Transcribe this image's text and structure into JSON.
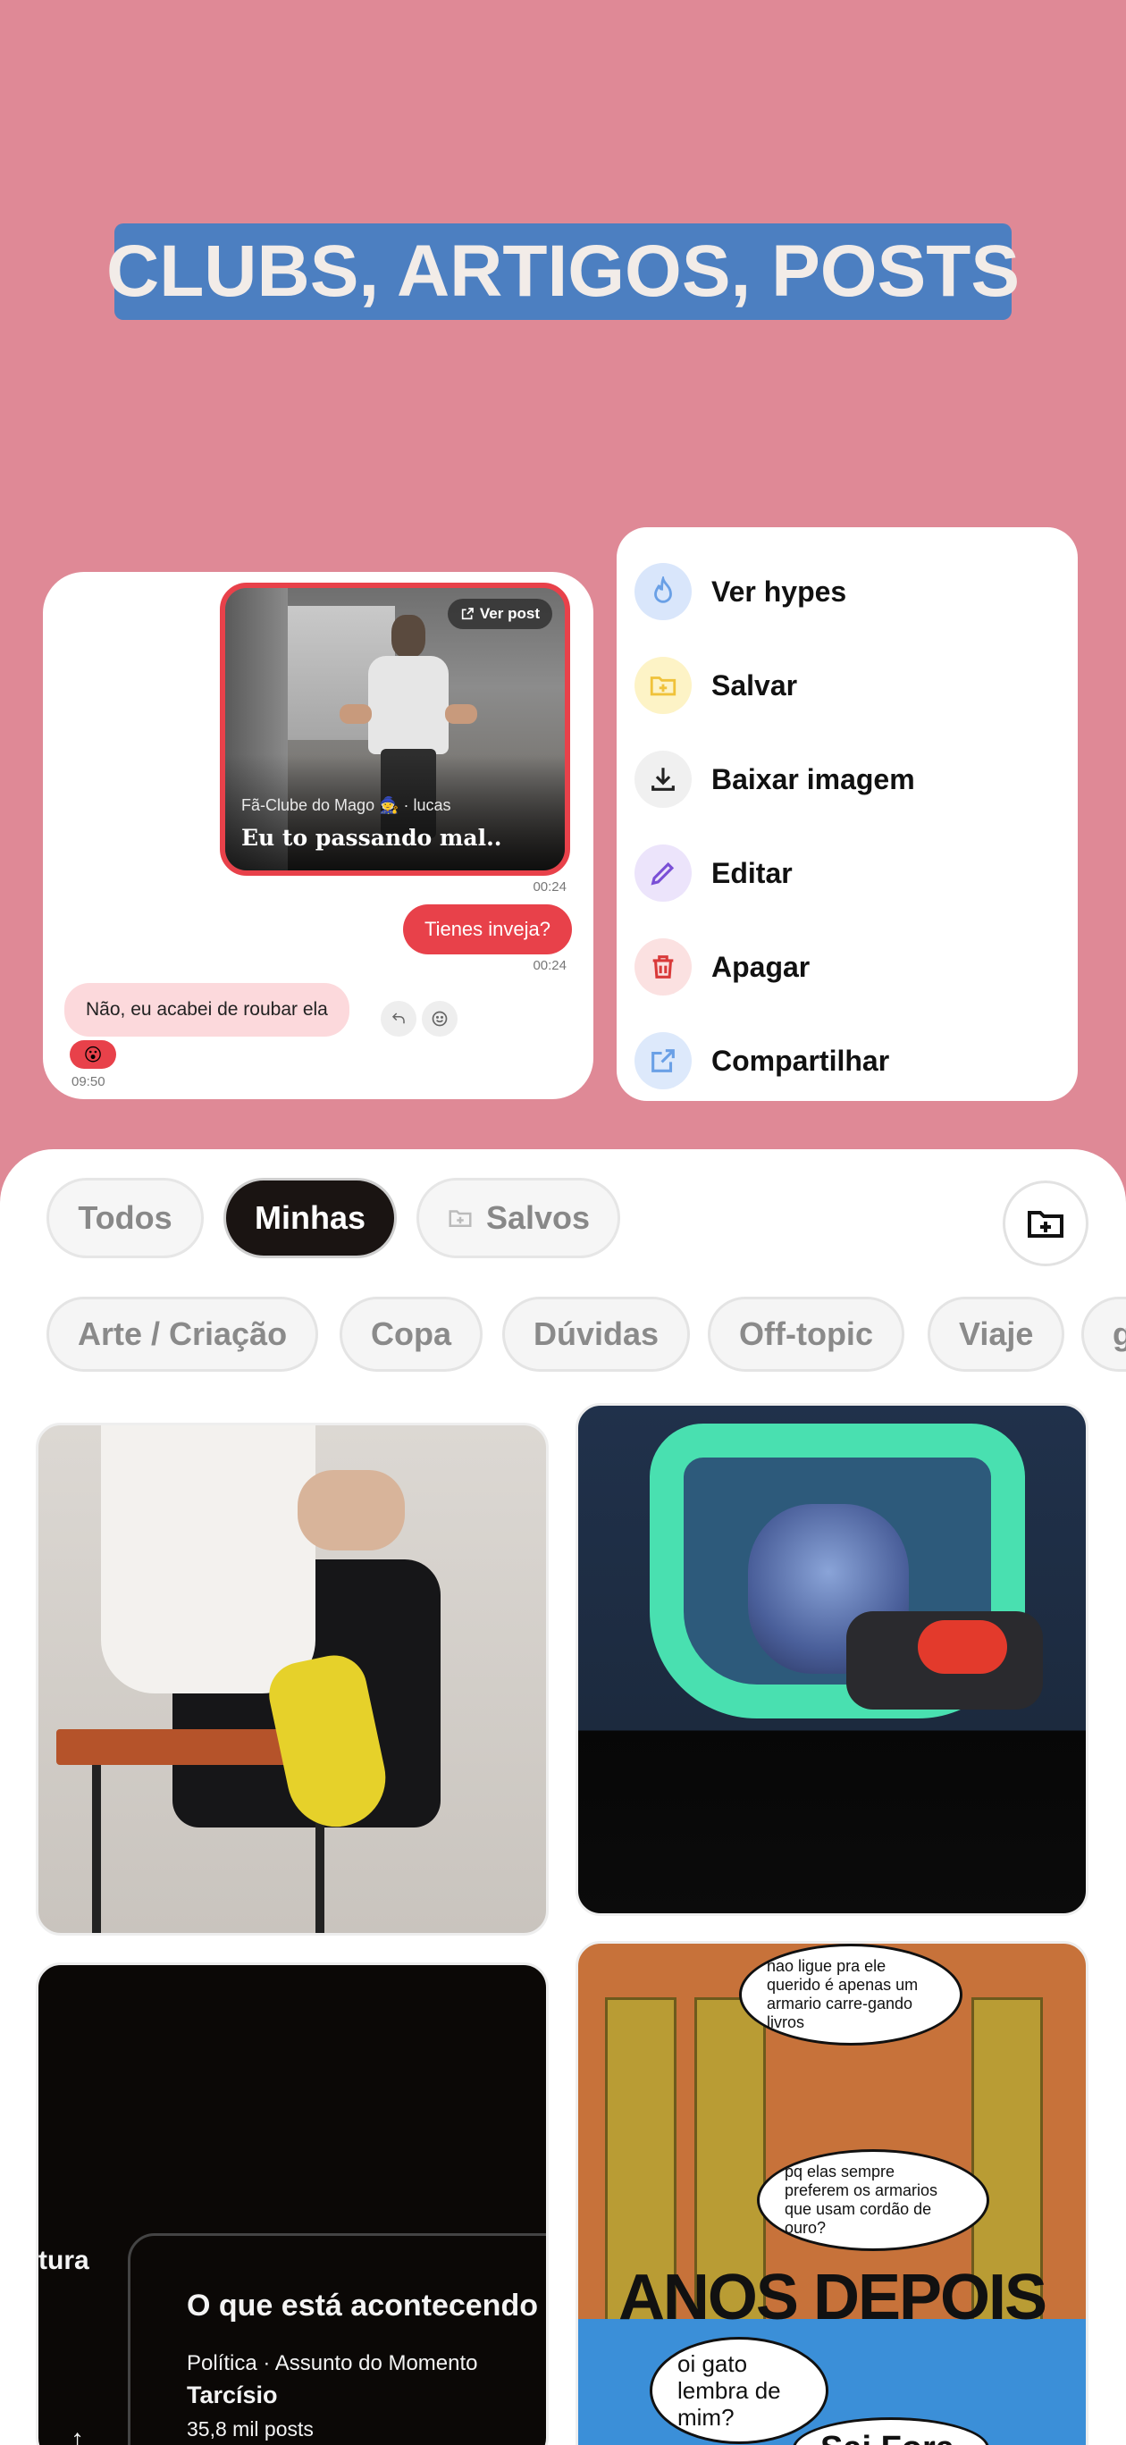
{
  "hero": {
    "title": "CLUBS, ARTIGOS, POSTS"
  },
  "chat": {
    "shared_post": {
      "button_label": "Ver post",
      "meta": "Fã-Clube do Mago 🧙 · lucas",
      "caption": "Eu to passando mal.."
    },
    "messages": [
      {
        "direction": "out",
        "type": "post",
        "time": "00:24"
      },
      {
        "direction": "out",
        "text": "Tienes inveja?",
        "time": "00:24"
      },
      {
        "direction": "in",
        "text": "Não, eu acabei de roubar ela",
        "time": "09:50",
        "reaction": "😮"
      }
    ]
  },
  "menu": {
    "items": [
      {
        "label": "Ver hypes",
        "icon": "flame-icon",
        "color": "#d9e6fb"
      },
      {
        "label": "Salvar",
        "icon": "folder-plus-icon",
        "color": "#fdf3c6"
      },
      {
        "label": "Baixar imagem",
        "icon": "download-icon",
        "color": "#f0f0f0"
      },
      {
        "label": "Editar",
        "icon": "pencil-icon",
        "color": "#ece4fb"
      },
      {
        "label": "Apagar",
        "icon": "trash-icon",
        "color": "#fbe1e1"
      },
      {
        "label": "Compartilhar",
        "icon": "share-icon",
        "color": "#dde9fb"
      }
    ]
  },
  "feed": {
    "tabs": [
      {
        "label": "Todos",
        "active": false
      },
      {
        "label": "Minhas",
        "active": true
      },
      {
        "label": "Salvos",
        "active": false
      }
    ],
    "categories": [
      "Arte / Criação",
      "Copa",
      "Dúvidas",
      "Off-topic",
      "Viaje",
      "g"
    ],
    "tiles": {
      "t3": {
        "side_text": "tura",
        "heading": "O que está acontecendo",
        "topic": "Política · Assunto do Momento",
        "name": "Tarcísio",
        "count": "35,8 mil posts"
      },
      "t4": {
        "bubble1": "nao ligue pra ele querido é apenas um armario carre-gando livros",
        "bubble2": "pq elas sempre preferem os armarios que usam cordão de ouro?",
        "banner": "ANOS DEPOIS",
        "bubble3": "oi gato lembra de mim?",
        "bubble4": "Sai Fora"
      }
    }
  },
  "colors": {
    "accent": "#e8414a",
    "background": "#df8996",
    "title_bg": "#4c7fc1"
  }
}
